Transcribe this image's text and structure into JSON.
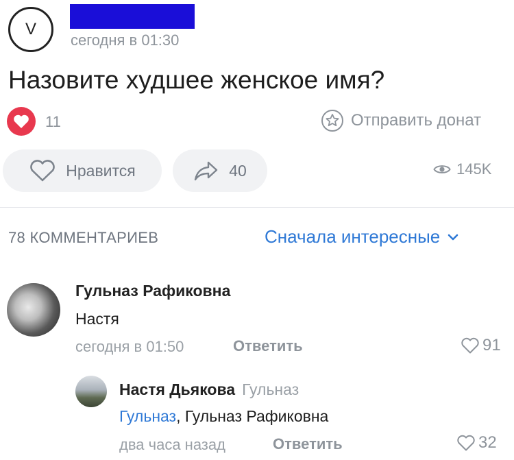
{
  "post": {
    "author_initial": "V",
    "time": "сегодня в 01:30",
    "title": "Назовите худшее женское имя?",
    "reaction_count": "11",
    "donate_label": "Отправить донат",
    "like_label": "Нравится",
    "share_count": "40",
    "views": "145K"
  },
  "comments_header": {
    "count_label": "78 КОММЕНТАРИЕВ",
    "sort_label": "Сначала интересные"
  },
  "comments": [
    {
      "author": "Гульназ Рафиковна",
      "text": "Настя",
      "time": "сегодня в 01:50",
      "reply_label": "Ответить",
      "likes": "91"
    },
    {
      "author": "Настя Дьякова",
      "reply_to": "Гульназ",
      "mention": "Гульназ",
      "text_rest": ", Гульназ Рафиковна",
      "time": "два часа назад",
      "reply_label": "Ответить",
      "likes": "32"
    }
  ],
  "colors": {
    "accent": "#2f79d6",
    "reaction_red": "#e8384e",
    "redaction": "#1a0ed8",
    "muted": "#8e949b"
  },
  "icons": [
    "heart-icon",
    "star-donate-icon",
    "share-arrow-icon",
    "eye-icon",
    "chevron-down-icon"
  ]
}
